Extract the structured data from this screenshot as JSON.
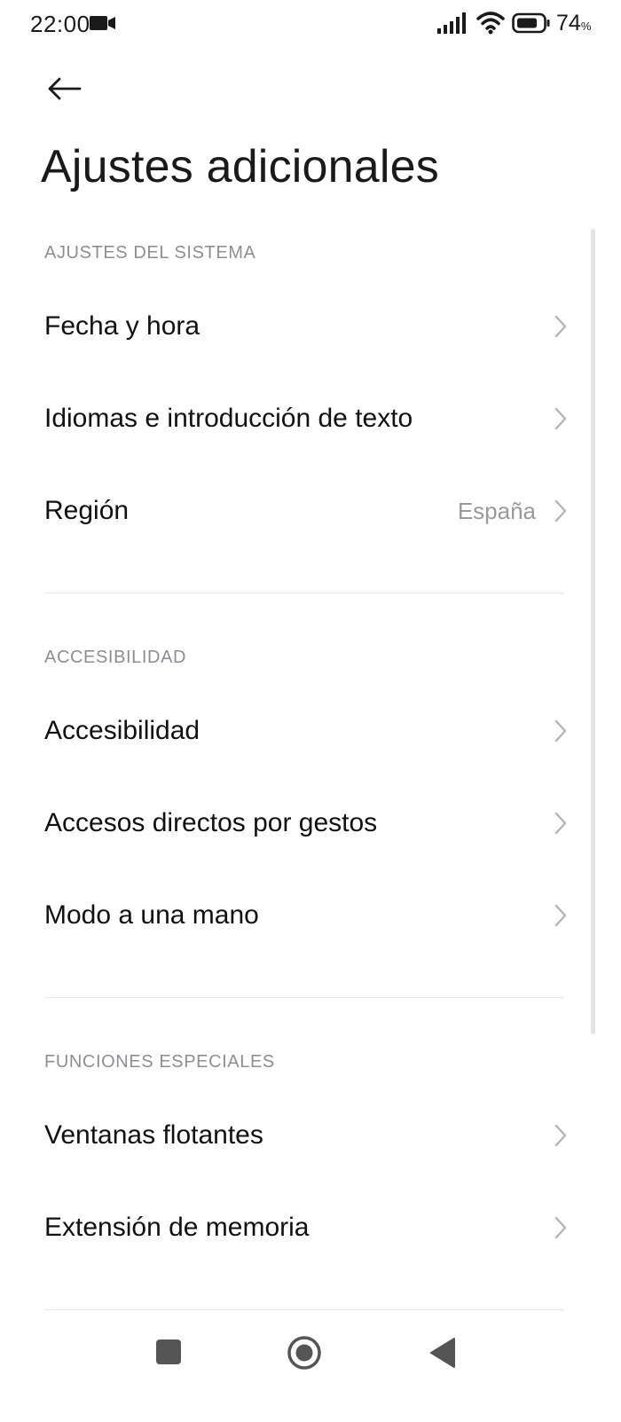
{
  "status_bar": {
    "time": "22:00",
    "battery_level": "74",
    "battery_unit": "%"
  },
  "header": {
    "back_icon": "arrow-left-icon",
    "title": "Ajustes adicionales"
  },
  "sections": {
    "system": {
      "header": "AJUSTES DEL SISTEMA",
      "items": [
        {
          "label": "Fecha y hora"
        },
        {
          "label": "Idiomas e introducción de texto"
        },
        {
          "label": "Región",
          "value": "España"
        }
      ]
    },
    "accessibility": {
      "header": "ACCESIBILIDAD",
      "items": [
        {
          "label": "Accesibilidad"
        },
        {
          "label": "Accesos directos por gestos"
        },
        {
          "label": "Modo a una mano"
        }
      ]
    },
    "special": {
      "header": "FUNCIONES ESPECIALES",
      "items": [
        {
          "label": "Ventanas flotantes"
        },
        {
          "label": "Extensión de memoria"
        }
      ]
    }
  },
  "nav_bar": {
    "icons": [
      "recents-square-icon",
      "home-circle-icon",
      "back-triangle-icon"
    ]
  },
  "colors": {
    "text_primary": "#111111",
    "text_secondary": "#8e8e93",
    "divider": "#e8e8e8",
    "chevron": "#b5b5b5",
    "nav_icon": "#555555"
  }
}
